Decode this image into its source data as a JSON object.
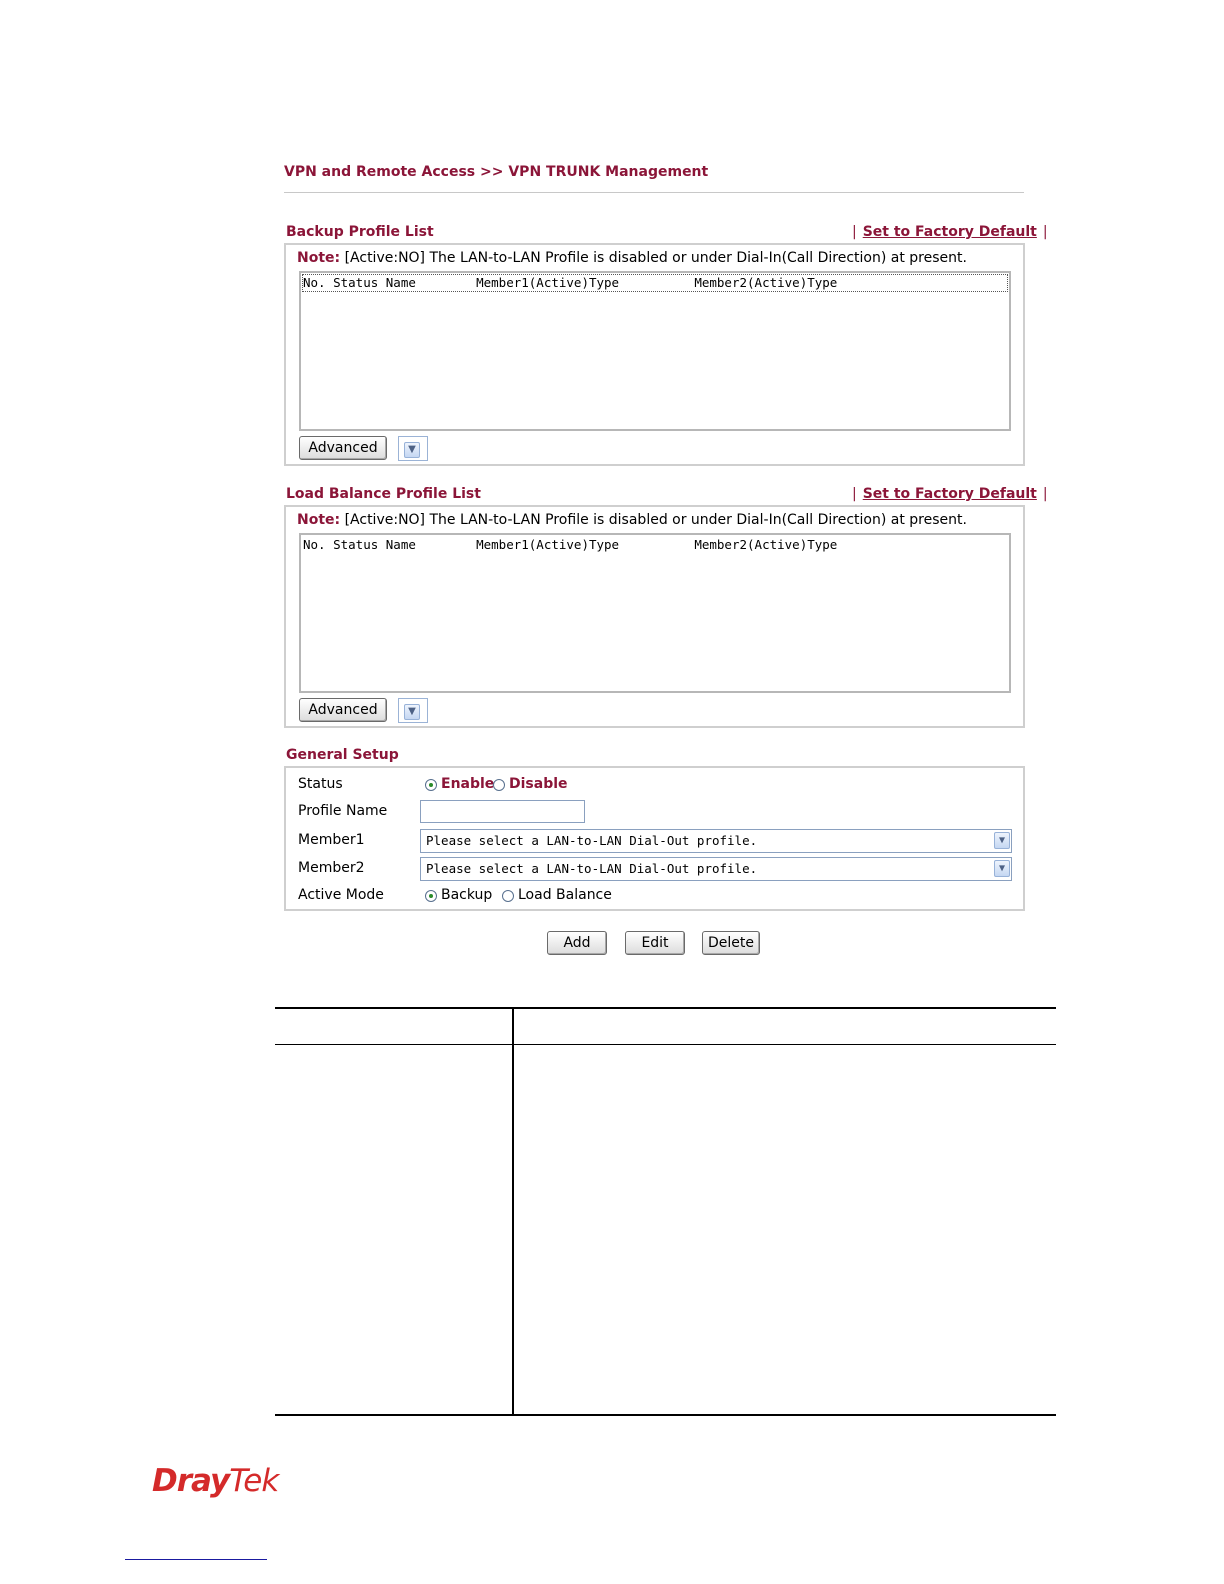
{
  "breadcrumb": "VPN and Remote Access >> VPN TRUNK Management",
  "backup": {
    "title": "Backup Profile List",
    "factory_link": "Set to Factory Default",
    "note_label": "Note:",
    "note_text": "[Active:NO] The LAN-to-LAN Profile is disabled or under Dial-In(Call Direction) at present.",
    "list_header": "No. Status Name        Member1(Active)Type          Member2(Active)Type",
    "advanced_label": "Advanced"
  },
  "loadbalance": {
    "title": "Load Balance Profile List",
    "factory_link": "Set to Factory Default",
    "note_label": "Note:",
    "note_text": "[Active:NO] The LAN-to-LAN Profile is disabled or under Dial-In(Call Direction) at present.",
    "list_header": "No. Status Name        Member1(Active)Type          Member2(Active)Type",
    "advanced_label": "Advanced"
  },
  "general": {
    "title": "General Setup",
    "status_label": "Status",
    "enable_label": "Enable",
    "disable_label": "Disable",
    "status_value": "Enable",
    "profile_name_label": "Profile Name",
    "profile_name_value": "",
    "member1_label": "Member1",
    "member1_value": "Please select a LAN-to-LAN Dial-Out profile.",
    "member2_label": "Member2",
    "member2_value": "Please select a LAN-to-LAN Dial-Out profile.",
    "active_mode_label": "Active Mode",
    "backup_label": "Backup",
    "loadbalance_label": "Load Balance",
    "active_mode_value": "Backup"
  },
  "actions": {
    "add": "Add",
    "edit": "Edit",
    "delete": "Delete"
  },
  "logo": {
    "part1": "Dray",
    "part2": "Tek"
  },
  "colors": {
    "accent": "#8b1538",
    "logo": "#d42a2a"
  }
}
